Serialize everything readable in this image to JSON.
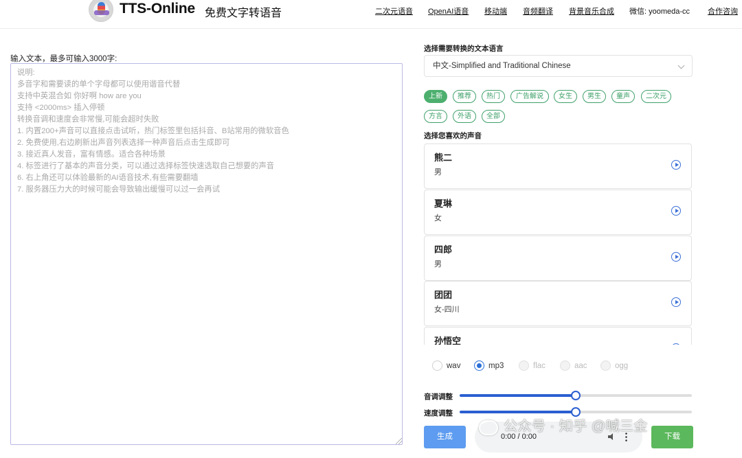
{
  "header": {
    "brand": "TTS-Online",
    "brand_sub": "免费文字转语音",
    "nav": [
      "二次元语音",
      "OpenAI语音",
      "移动端",
      "音频翻译",
      "背景音乐合成",
      "微信: yoomeda-cc",
      "合作咨询"
    ]
  },
  "input": {
    "label": "输入文本，最多可输入3000字:",
    "placeholder": "说明:\n多音字和需要读的单个字母都可以使用谐音代替\n支持中英混合如 你好啊 how are you\n支持 <2000ms> 插入停顿\n转换音调和速度会非常慢,可能会超时失败\n1. 内置200+声音可以直接点击试听，热门标签里包括抖音、B站常用的微软音色\n2. 免费使用,右边刷新出声音列表选择一种声音后点击生成即可\n3. 接近真人发音，富有情感。适合各种场景\n4. 标签进行了基本的声音分类，可以通过选择标签快速选取自己想要的声音\n6. 右上角还可以体验最新的AI语音技术,有些需要翻墙\n7. 服务器压力大的时候可能会导致输出缓慢可以过一会再试"
  },
  "language": {
    "label": "选择需要转换的文本语言",
    "selected": "中文-Simplified and Traditional Chinese"
  },
  "tags": [
    "上新",
    "推荐",
    "热门",
    "广告解说",
    "女生",
    "男生",
    "童声",
    "二次元",
    "方言",
    "外语",
    "全部"
  ],
  "voices": {
    "label": "选择您喜欢的声音",
    "items": [
      {
        "name": "熊二",
        "sub": "男"
      },
      {
        "name": "夏琳",
        "sub": "女"
      },
      {
        "name": "四郎",
        "sub": "男"
      },
      {
        "name": "团团",
        "sub": "女-四川"
      },
      {
        "name": "孙悟空",
        "sub": ""
      }
    ]
  },
  "formats": [
    {
      "label": "wav",
      "checked": false,
      "disabled": false
    },
    {
      "label": "mp3",
      "checked": true,
      "disabled": false
    },
    {
      "label": "flac",
      "checked": false,
      "disabled": true
    },
    {
      "label": "aac",
      "checked": false,
      "disabled": true
    },
    {
      "label": "ogg",
      "checked": false,
      "disabled": true
    }
  ],
  "sliders": {
    "pitch": {
      "label": "音调调整",
      "value": 0.5
    },
    "speed": {
      "label": "速度调整",
      "value": 0.5
    }
  },
  "actions": {
    "generate": "生成",
    "download": "下载"
  },
  "player": {
    "time": "0:00 / 0:00"
  },
  "watermark": "公众号 · 知乎 @喊三金",
  "colors": {
    "tag_green": "#3fa06a",
    "primary_blue": "#2b5fd0",
    "generate_blue": "#5d9cf0",
    "download_green": "#5cb85c"
  }
}
